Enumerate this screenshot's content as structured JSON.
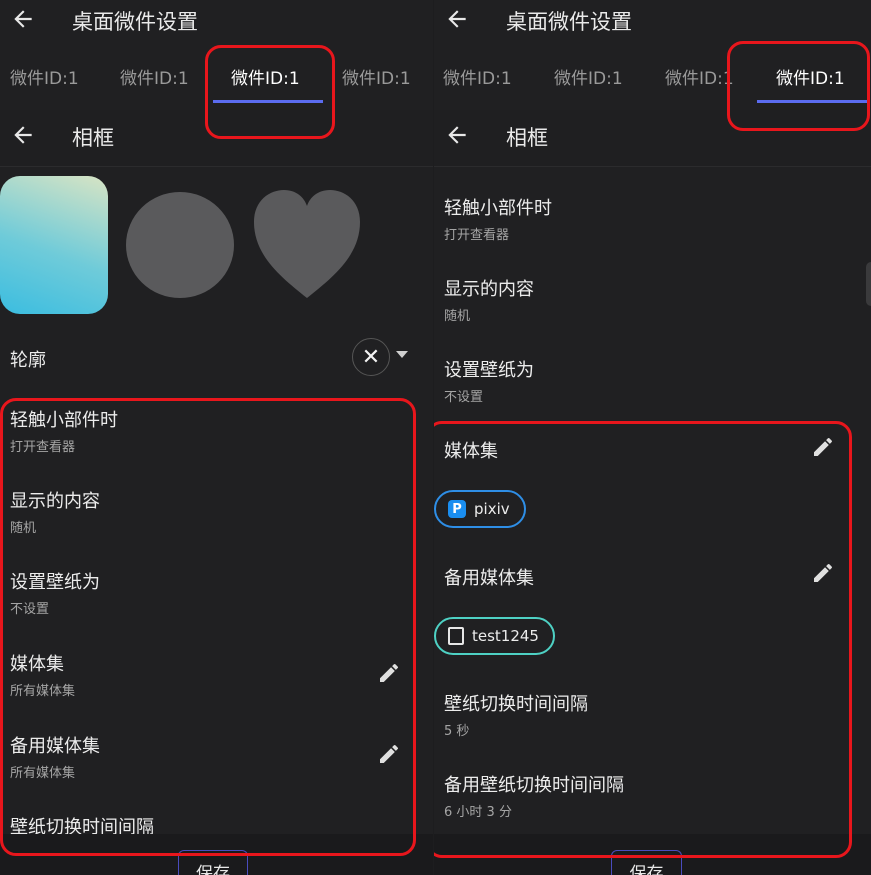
{
  "left": {
    "header_title": "桌面微件设置",
    "tabs": [
      "微件ID:1",
      "微件ID:1",
      "微件ID:1",
      "微件ID:1"
    ],
    "sub_title": "相框",
    "outline": {
      "label": "轮廓"
    },
    "settings": [
      {
        "title": "轻触小部件时",
        "sub": "打开查看器"
      },
      {
        "title": "显示的内容",
        "sub": "随机"
      },
      {
        "title": "设置壁纸为",
        "sub": "不设置"
      },
      {
        "title": "媒体集",
        "sub": "所有媒体集"
      },
      {
        "title": "备用媒体集",
        "sub": "所有媒体集"
      },
      {
        "title": "壁纸切换时间间隔",
        "sub": ""
      }
    ],
    "save_label": "保存"
  },
  "right": {
    "header_title": "桌面微件设置",
    "tabs": [
      "微件ID:1",
      "微件ID:1",
      "微件ID:1",
      "微件ID:1"
    ],
    "sub_title": "相框",
    "settings": [
      {
        "title": "轻触小部件时",
        "sub": "打开查看器"
      },
      {
        "title": "显示的内容",
        "sub": "随机"
      },
      {
        "title": "设置壁纸为",
        "sub": "不设置"
      }
    ],
    "media_set": {
      "title": "媒体集",
      "chip": "pixiv"
    },
    "backup_media_set": {
      "title": "备用媒体集",
      "chip": "test1245"
    },
    "interval": {
      "title": "壁纸切换时间间隔",
      "sub": "5 秒"
    },
    "backup_interval": {
      "title": "备用壁纸切换时间间隔",
      "sub": "6 小时 3 分"
    },
    "save_label": "保存"
  },
  "colors": {
    "accent": "#5b6cf0",
    "highlight": "#e8161c",
    "chip_blue": "#2e8ee6",
    "chip_teal": "#4ed1c4"
  }
}
